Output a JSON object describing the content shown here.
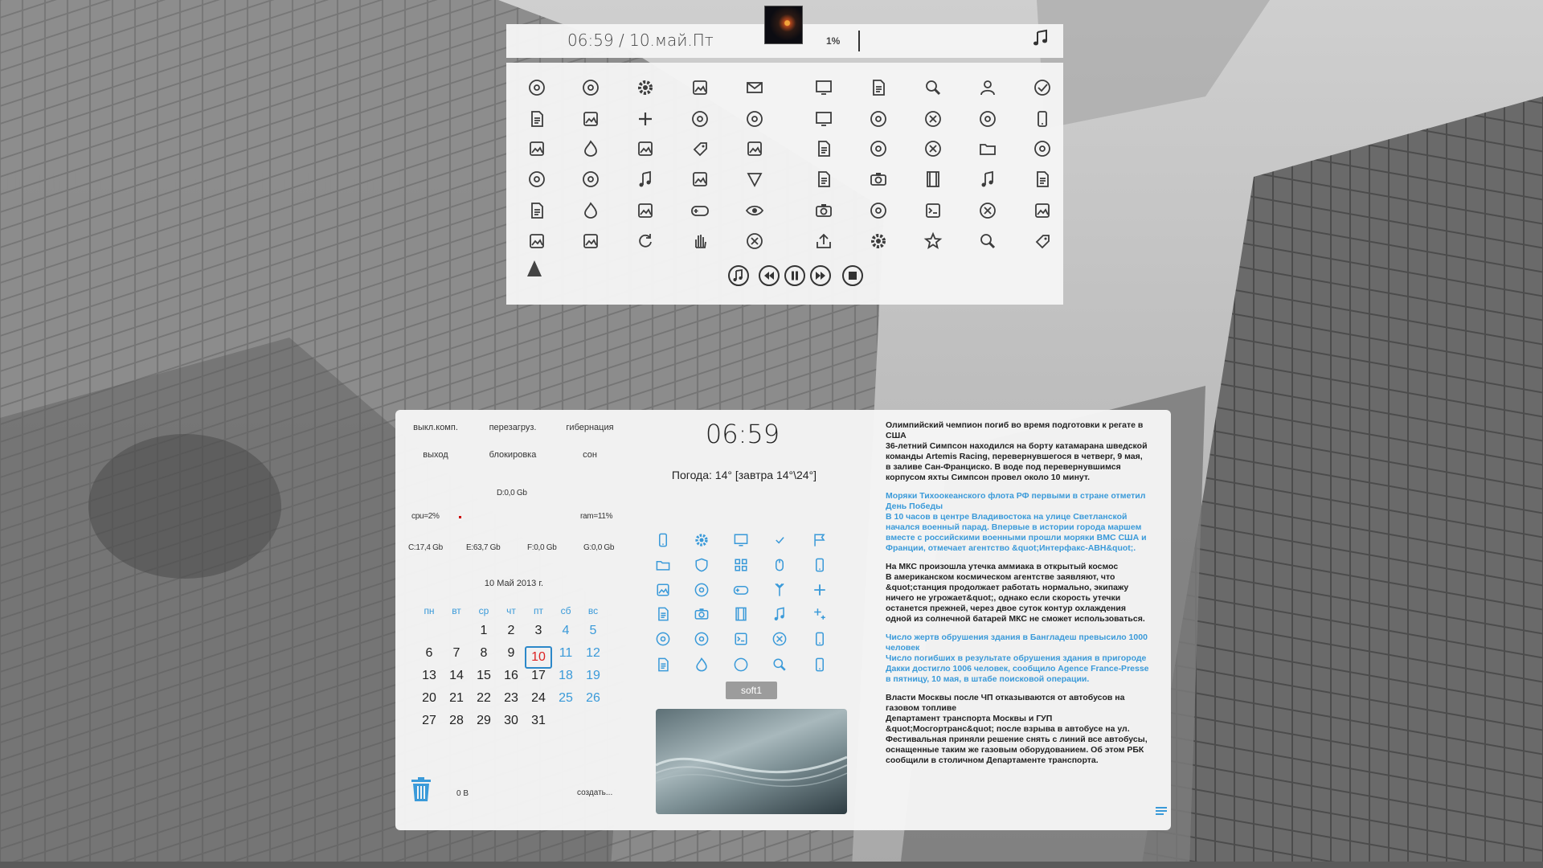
{
  "top_panel": {
    "datetime": "06:59 / 10.май.Пт",
    "volume": "1%",
    "icons_rows": [
      [
        "history-icon",
        "aperture-icon",
        "gear-icon",
        "edit-circle-icon",
        "mail-icon",
        "window-icon",
        "document-list-icon",
        "monitor-search-icon",
        "user-icon",
        "check-circle-icon"
      ],
      [
        "note-edit-icon",
        "archive-icon",
        "grid-plus-icon",
        "globe-icon",
        "target-icon",
        "copy-window-icon",
        "chart-pie-icon",
        "x-box-icon",
        "pizza-icon",
        "phone-icon"
      ],
      [
        "photoshop-icon",
        "fireworks-icon",
        "brush-icon",
        "tag-icon",
        "xbox-icon",
        "document-lines-icon",
        "disc-icon",
        "apps-x-icon",
        "folder-image-icon",
        "palette-icon"
      ],
      [
        "leaf-icon",
        "leaf-outline-icon",
        "music-file-icon",
        "image-file-icon",
        "triangle-down-icon",
        "notes-icon",
        "camera-icon",
        "film-icon",
        "music-notes-icon",
        "document-stack-icon"
      ],
      [
        "calendar-lines-icon",
        "fire-icon",
        "no-signal-icon",
        "gamepad-icon",
        "eye-icon",
        "photo-camera-icon",
        "record-icon",
        "terminal-icon",
        "close-circle-icon",
        "copy-icon"
      ],
      [
        "easel-icon",
        "image-frame-icon",
        "refresh-icon",
        "hand-icon",
        "cancel-circle-icon",
        "share-icon",
        "settings-box-icon",
        "star-icon",
        "search-icon",
        "link-icon"
      ]
    ]
  },
  "bottom_panel": {
    "power": {
      "shutdown": "выкл.комп.",
      "reboot": "перезагруз.",
      "hibernate": "гибернация",
      "logout": "выход",
      "lock": "блокировка",
      "sleep": "сон"
    },
    "stats": {
      "disk_d": "D:0,0 Gb",
      "cpu": "cpu=2%",
      "ram": "ram=11%",
      "disk_c": "C:17,4 Gb",
      "disk_e": "E:63,7 Gb",
      "disk_f": "F:0,0 Gb",
      "disk_g": "G:0,0 Gb"
    },
    "calendar": {
      "title": "10 Май 2013 г.",
      "weekdays": [
        "пн",
        "вт",
        "ср",
        "чт",
        "пт",
        "сб",
        "вс"
      ],
      "weeks": [
        [
          "",
          "",
          "1",
          "2",
          "3",
          "4",
          "5"
        ],
        [
          "6",
          "7",
          "8",
          "9",
          "10",
          "11",
          "12"
        ],
        [
          "13",
          "14",
          "15",
          "16",
          "17",
          "18",
          "19"
        ],
        [
          "20",
          "21",
          "22",
          "23",
          "24",
          "25",
          "26"
        ],
        [
          "27",
          "28",
          "29",
          "30",
          "31",
          "",
          ""
        ]
      ],
      "today": "10"
    },
    "trash": {
      "size": "0 B",
      "create": "создать..."
    },
    "clock": "06:59",
    "weather": "Погода:  14° [завтра 14°\\24°]",
    "soft_button": "soft1",
    "news": [
      {
        "style": "dark",
        "title": "Олимпийский чемпион погиб во время подготовки к регате в США",
        "body": "36-летний Симпсон находился на борту катамарана шведской команды Artemis Racing, перевернувшегося в четверг, 9 мая, в заливе Сан-Франциско. В воде под перевернувшимся корпусом яхты Симпсон провел около 10 минут."
      },
      {
        "style": "blue",
        "title": "Моряки Тихоокеанского флота РФ первыми в стране отметил День Победы",
        "body": "В 10 часов в центре Владивостока на улице Светланской начался военный парад. Впервые в истории города маршем вместе с российскими военными прошли моряки ВМС США и Франции, отмечает агентство &quot;Интерфакс-АВН&quot;."
      },
      {
        "style": "dark",
        "title": "На МКС произошла утечка аммиака в открытый космос",
        "body": "В американском космическом агентстве заявляют, что &quot;станция продолжает работать нормально, экипажу ничего не угрожает&quot;, однако если скорость утечки останется прежней, через двое суток контур охлаждения одной из солнечной батарей МКС не сможет использоваться."
      },
      {
        "style": "blue",
        "title": "Число жертв обрушения здания в Бангладеш превысило 1000 человек",
        "body": "Число погибших в результате обрушения здания в пригороде Дакки достигло 1006 человек, сообщило Agence France-Presse в пятницу, 10 мая, в штабе поисковой операции."
      },
      {
        "style": "dark",
        "title": "Власти Москвы после ЧП отказываются от автобусов на газовом топливе",
        "body": "Департамент транспорта Москвы и ГУП &quot;Мосгортранс&quot; после взрыва в автобусе на ул. Фестивальная приняли решение снять с линий все автобусы, оснащенные таким же газовым оборудованием. Об этом РБК сообщили в столичном Департаменте транспорта."
      }
    ],
    "launcher_icons": [
      [
        "tablet-icon",
        "picture-settings-icon",
        "monitor-icon",
        "checkmark-icon",
        "flag-icon"
      ],
      [
        "folder-icon",
        "shield-icon",
        "grid-icon",
        "mouse-icon",
        "phone-icon"
      ],
      [
        "edit-icon",
        "disc-icon",
        "gamepad-icon",
        "antenna-icon",
        "plus-icon"
      ],
      [
        "text-align-icon",
        "camera-icon",
        "film-icon",
        "music-icon",
        "sparkle-icon"
      ],
      [
        "palette-icon",
        "chat-icon",
        "terminal-icon",
        "close-icon",
        "mobile-icon"
      ],
      [
        "calculator-icon",
        "fire-icon",
        "box-icon",
        "search-icon",
        "battery-icon"
      ]
    ],
    "accent": "#3a9ad9"
  }
}
